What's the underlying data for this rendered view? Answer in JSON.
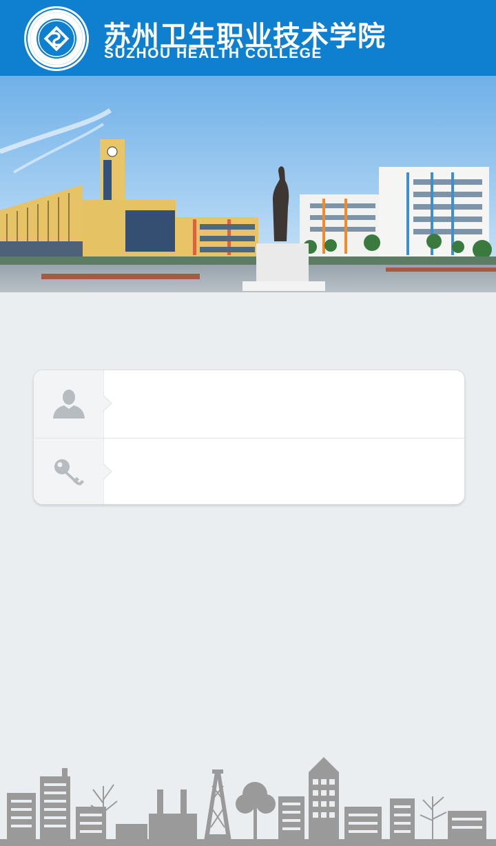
{
  "header": {
    "brand_cn": "苏州卫生职业技术学院",
    "brand_en": "SUZHOU HEALTH COLLEGE",
    "logo_ring_text": "苏州卫生职业技术学院",
    "logo_ring_text_en": "SUZHOU HEALTH COLLEGE",
    "color": "#0f7fd0"
  },
  "banner": {
    "description_icon": "campus-photo"
  },
  "login": {
    "username_icon": "user-icon",
    "password_icon": "key-icon",
    "username_value": "",
    "password_value": ""
  },
  "footer": {
    "illustration": "city-skyline"
  },
  "colors": {
    "background": "#eaeef1",
    "header": "#0f7fd0",
    "skyline": "#9a9a9a"
  }
}
